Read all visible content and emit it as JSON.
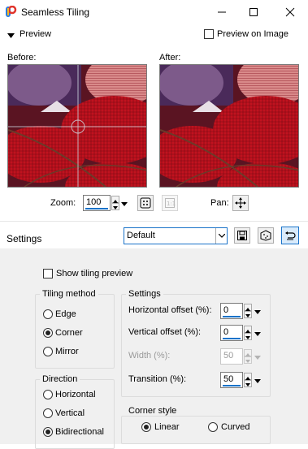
{
  "window": {
    "title": "Seamless Tiling"
  },
  "preview_section": {
    "label": "Preview",
    "preview_on_image_label": "Preview on Image",
    "before_label": "Before:",
    "after_label": "After:",
    "zoom_label": "Zoom:",
    "zoom_value": "100",
    "pan_label": "Pan:"
  },
  "settings": {
    "label": "Settings",
    "preset_value": "Default"
  },
  "options": {
    "show_tiling_preview_label": "Show tiling preview",
    "tiling_method": {
      "title": "Tiling method",
      "options": [
        "Edge",
        "Corner",
        "Mirror"
      ],
      "selected": "Corner"
    },
    "direction": {
      "title": "Direction",
      "options": [
        "Horizontal",
        "Vertical",
        "Bidirectional"
      ],
      "selected": "Bidirectional"
    },
    "settings_group": {
      "title": "Settings",
      "horizontal_offset_label": "Horizontal offset (%):",
      "horizontal_offset_value": "0",
      "vertical_offset_label": "Vertical offset (%):",
      "vertical_offset_value": "0",
      "width_label": "Width (%):",
      "width_value": "50",
      "transition_label": "Transition (%):",
      "transition_value": "50"
    },
    "corner_style": {
      "title": "Corner style",
      "options": [
        "Linear",
        "Curved"
      ],
      "selected": "Linear"
    }
  }
}
